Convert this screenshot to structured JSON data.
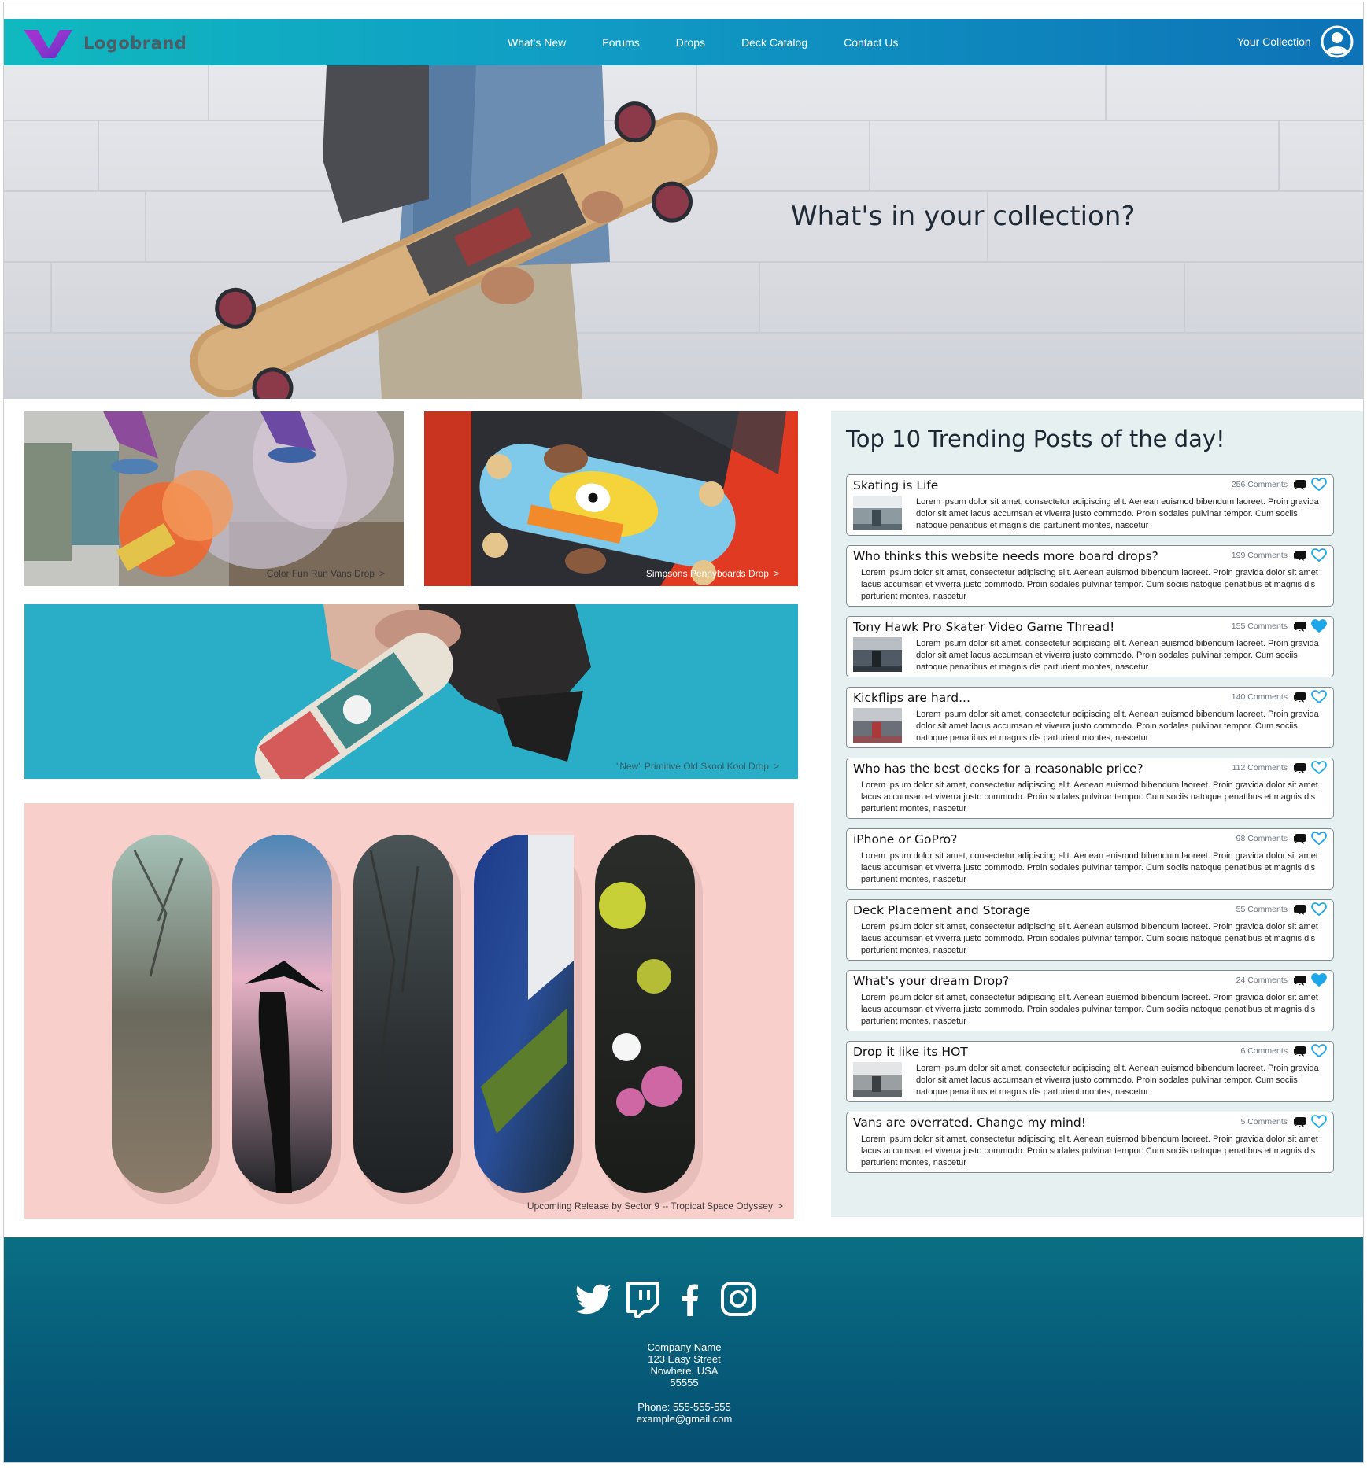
{
  "brand": {
    "logo_text": "Logobrand",
    "accent": "#8b2fd0"
  },
  "nav": {
    "links": [
      "What's New",
      "Forums",
      "Drops",
      "Deck Catalog",
      "Contact Us"
    ],
    "collection_label": "Your Collection"
  },
  "hero": {
    "title": "What's in your collection?"
  },
  "tiles": [
    {
      "caption": "Color Fun Run Vans Drop",
      "chevron": ">"
    },
    {
      "caption": "Simpsons Pennyboards Drop",
      "chevron": ">"
    },
    {
      "caption": "\"New\" Primitive Old Skool Kool Drop",
      "chevron": ">"
    },
    {
      "caption": "Upcomiing Release by Sector 9 -- Tropical Space Odyssey",
      "chevron": ">"
    }
  ],
  "trending": {
    "title": "Top 10 Trending Posts of the day!",
    "posts": [
      {
        "title": "Skating is Life",
        "comments": "256 Comments",
        "liked": false,
        "thumb": true,
        "body": "Lorem ipsum dolor sit amet, consectetur adipiscing elit. Aenean euismod bibendum laoreet. Proin gravida dolor sit amet lacus accumsan et viverra justo commodo. Proin sodales pulvinar tempor. Cum sociis natoque penatibus et magnis dis parturient montes, nascetur"
      },
      {
        "title": "Who thinks this website needs more board drops?",
        "comments": "199 Comments",
        "liked": false,
        "thumb": false,
        "body": "Lorem ipsum dolor sit amet, consectetur adipiscing elit. Aenean euismod bibendum laoreet. Proin gravida dolor sit amet lacus accumsan et viverra justo commodo. Proin sodales pulvinar tempor. Cum sociis natoque penatibus et magnis dis parturient montes, nascetur"
      },
      {
        "title": "Tony Hawk Pro Skater Video Game Thread!",
        "comments": "155 Comments",
        "liked": true,
        "thumb": true,
        "body": "Lorem ipsum dolor sit amet, consectetur adipiscing elit. Aenean euismod bibendum laoreet. Proin gravida dolor sit amet lacus accumsan et viverra justo commodo. Proin sodales pulvinar tempor. Cum sociis natoque penatibus et magnis dis parturient montes, nascetur"
      },
      {
        "title": "Kickflips are hard...",
        "comments": "140 Comments",
        "liked": false,
        "thumb": true,
        "body": "Lorem ipsum dolor sit amet, consectetur adipiscing elit. Aenean euismod bibendum laoreet. Proin gravida dolor sit amet lacus accumsan et viverra justo commodo. Proin sodales pulvinar tempor. Cum sociis natoque penatibus et magnis dis parturient montes, nascetur"
      },
      {
        "title": "Who has the best decks for a reasonable price?",
        "comments": "112 Comments",
        "liked": false,
        "thumb": false,
        "body": "Lorem ipsum dolor sit amet, consectetur adipiscing elit. Aenean euismod bibendum laoreet. Proin gravida dolor sit amet lacus accumsan et viverra justo commodo. Proin sodales pulvinar tempor. Cum sociis natoque penatibus et magnis dis parturient montes, nascetur"
      },
      {
        "title": "iPhone or GoPro?",
        "comments": "98 Comments",
        "liked": false,
        "thumb": false,
        "body": "Lorem ipsum dolor sit amet, consectetur adipiscing elit. Aenean euismod bibendum laoreet. Proin gravida dolor sit amet lacus accumsan et viverra justo commodo. Proin sodales pulvinar tempor. Cum sociis natoque penatibus et magnis dis parturient montes, nascetur"
      },
      {
        "title": "Deck Placement and Storage",
        "comments": "55 Comments",
        "liked": false,
        "thumb": false,
        "body": "Lorem ipsum dolor sit amet, consectetur adipiscing elit. Aenean euismod bibendum laoreet. Proin gravida dolor sit amet lacus accumsan et viverra justo commodo. Proin sodales pulvinar tempor. Cum sociis natoque penatibus et magnis dis parturient montes, nascetur"
      },
      {
        "title": "What's your dream Drop?",
        "comments": "24 Comments",
        "liked": true,
        "thumb": false,
        "body": "Lorem ipsum dolor sit amet, consectetur adipiscing elit. Aenean euismod bibendum laoreet. Proin gravida dolor sit amet lacus accumsan et viverra justo commodo. Proin sodales pulvinar tempor. Cum sociis natoque penatibus et magnis dis parturient montes, nascetur"
      },
      {
        "title": "Drop it like its HOT",
        "comments": "6 Comments",
        "liked": false,
        "thumb": true,
        "body": "Lorem ipsum dolor sit amet, consectetur adipiscing elit. Aenean euismod bibendum laoreet. Proin gravida dolor sit amet lacus accumsan et viverra justo commodo. Proin sodales pulvinar tempor. Cum sociis natoque penatibus et magnis dis parturient montes, nascetur"
      },
      {
        "title": "Vans are overrated. Change my mind!",
        "comments": "5 Comments",
        "liked": false,
        "thumb": false,
        "body": "Lorem ipsum dolor sit amet, consectetur adipiscing elit. Aenean euismod bibendum laoreet. Proin gravida dolor sit amet lacus accumsan et viverra justo commodo. Proin sodales pulvinar tempor. Cum sociis natoque penatibus et magnis dis parturient montes, nascetur"
      }
    ]
  },
  "footer": {
    "socials": [
      "twitter-icon",
      "twitch-icon",
      "facebook-icon",
      "instagram-icon"
    ],
    "address": [
      "Company Name",
      "123 Easy Street",
      "Nowhere, USA",
      "55555"
    ],
    "phone": "Phone: 555-555-555",
    "email": "example@gmail.com"
  },
  "colors": {
    "heart_liked": "#1ea7e8",
    "heart_outline": "#1ea7e8"
  }
}
